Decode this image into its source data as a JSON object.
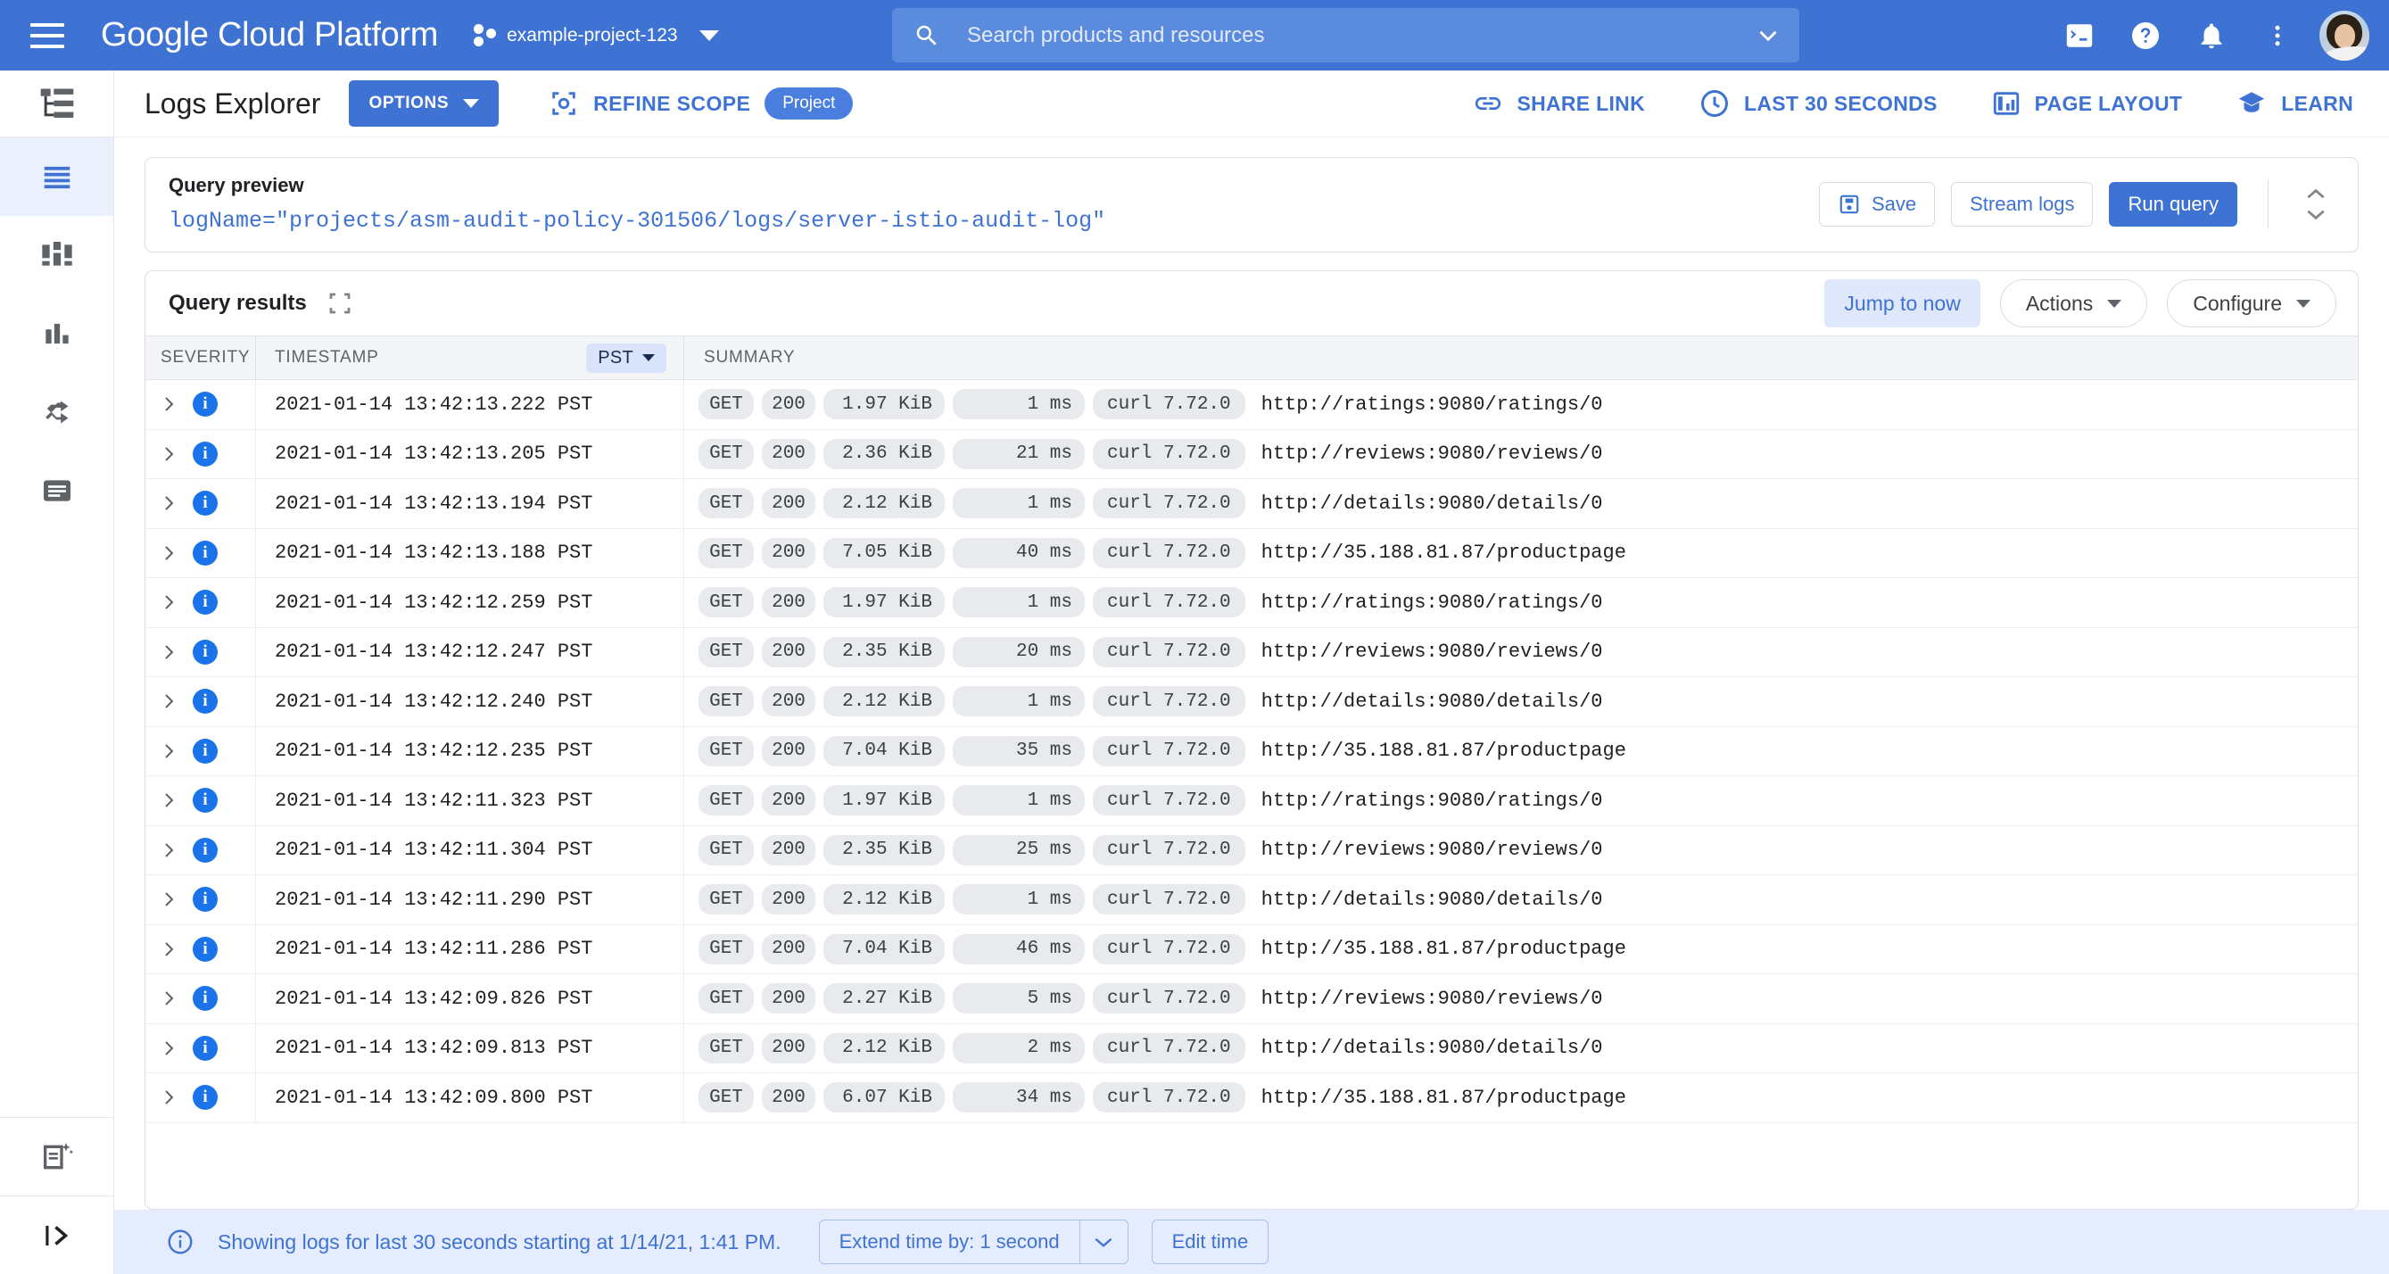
{
  "topbar": {
    "menu_icon": "hamburger-menu-icon",
    "brand": "Google Cloud Platform",
    "project_name": "example-project-123",
    "project_icon": "project-dots-icon",
    "search": {
      "placeholder": "Search products and resources",
      "icon": "search-icon",
      "expand_icon": "chevron-down-icon"
    },
    "icons": [
      "cloud-shell-icon",
      "help-icon",
      "notifications-bell-icon",
      "more-vert-icon",
      "user-avatar"
    ]
  },
  "rail": {
    "top_icon": "logs-hierarchy-icon",
    "items": [
      {
        "name": "logs-explorer",
        "icon": "logs-list-icon",
        "active": true
      },
      {
        "name": "logs-dashboard",
        "icon": "dashboard-icon",
        "active": false
      },
      {
        "name": "logs-metrics",
        "icon": "bar-chart-icon",
        "active": false
      },
      {
        "name": "logs-router",
        "icon": "shuffle-icon",
        "active": false
      },
      {
        "name": "logs-storage",
        "icon": "log-document-icon",
        "active": false
      }
    ],
    "bottom_items": [
      {
        "name": "log-analytics",
        "icon": "smart-document-sparkle-icon"
      },
      {
        "name": "expand-panel",
        "icon": "expand-right-icon"
      }
    ]
  },
  "header": {
    "title": "Logs Explorer",
    "options_label": "OPTIONS",
    "refine_scope_label": "REFINE SCOPE",
    "refine_scope_icon": "scope-target-icon",
    "scope_chip": "Project",
    "actions": [
      {
        "label": "SHARE LINK",
        "icon": "link-icon"
      },
      {
        "label": "LAST 30 SECONDS",
        "icon": "clock-icon"
      },
      {
        "label": "PAGE LAYOUT",
        "icon": "page-layout-icon"
      },
      {
        "label": "LEARN",
        "icon": "learn-book-icon"
      }
    ]
  },
  "query_preview": {
    "title": "Query preview",
    "query": "logName=\"projects/asm-audit-policy-301506/logs/server-istio-audit-log\"",
    "save_label": "Save",
    "save_icon": "save-icon",
    "stream_label": "Stream logs",
    "run_label": "Run query",
    "collapse_icon": "expand-collapse-icon"
  },
  "query_results": {
    "title": "Query results",
    "expand_icon": "fullscreen-icon",
    "jump_label": "Jump to now",
    "actions_label": "Actions",
    "configure_label": "Configure",
    "columns": {
      "severity": "SEVERITY",
      "timestamp": "TIMESTAMP",
      "timezone": "PST",
      "summary": "SUMMARY"
    },
    "rows": [
      {
        "severity": "INFO",
        "timestamp": "2021-01-14 13:42:13.222 PST",
        "method": "GET",
        "status": "200",
        "size": "1.97 KiB",
        "latency": "1 ms",
        "agent": "curl 7.72.0",
        "url": "http://ratings:9080/ratings/0"
      },
      {
        "severity": "INFO",
        "timestamp": "2021-01-14 13:42:13.205 PST",
        "method": "GET",
        "status": "200",
        "size": "2.36 KiB",
        "latency": "21 ms",
        "agent": "curl 7.72.0",
        "url": "http://reviews:9080/reviews/0"
      },
      {
        "severity": "INFO",
        "timestamp": "2021-01-14 13:42:13.194 PST",
        "method": "GET",
        "status": "200",
        "size": "2.12 KiB",
        "latency": "1 ms",
        "agent": "curl 7.72.0",
        "url": "http://details:9080/details/0"
      },
      {
        "severity": "INFO",
        "timestamp": "2021-01-14 13:42:13.188 PST",
        "method": "GET",
        "status": "200",
        "size": "7.05 KiB",
        "latency": "40 ms",
        "agent": "curl 7.72.0",
        "url": "http://35.188.81.87/productpage"
      },
      {
        "severity": "INFO",
        "timestamp": "2021-01-14 13:42:12.259 PST",
        "method": "GET",
        "status": "200",
        "size": "1.97 KiB",
        "latency": "1 ms",
        "agent": "curl 7.72.0",
        "url": "http://ratings:9080/ratings/0"
      },
      {
        "severity": "INFO",
        "timestamp": "2021-01-14 13:42:12.247 PST",
        "method": "GET",
        "status": "200",
        "size": "2.35 KiB",
        "latency": "20 ms",
        "agent": "curl 7.72.0",
        "url": "http://reviews:9080/reviews/0"
      },
      {
        "severity": "INFO",
        "timestamp": "2021-01-14 13:42:12.240 PST",
        "method": "GET",
        "status": "200",
        "size": "2.12 KiB",
        "latency": "1 ms",
        "agent": "curl 7.72.0",
        "url": "http://details:9080/details/0"
      },
      {
        "severity": "INFO",
        "timestamp": "2021-01-14 13:42:12.235 PST",
        "method": "GET",
        "status": "200",
        "size": "7.04 KiB",
        "latency": "35 ms",
        "agent": "curl 7.72.0",
        "url": "http://35.188.81.87/productpage"
      },
      {
        "severity": "INFO",
        "timestamp": "2021-01-14 13:42:11.323 PST",
        "method": "GET",
        "status": "200",
        "size": "1.97 KiB",
        "latency": "1 ms",
        "agent": "curl 7.72.0",
        "url": "http://ratings:9080/ratings/0"
      },
      {
        "severity": "INFO",
        "timestamp": "2021-01-14 13:42:11.304 PST",
        "method": "GET",
        "status": "200",
        "size": "2.35 KiB",
        "latency": "25 ms",
        "agent": "curl 7.72.0",
        "url": "http://reviews:9080/reviews/0"
      },
      {
        "severity": "INFO",
        "timestamp": "2021-01-14 13:42:11.290 PST",
        "method": "GET",
        "status": "200",
        "size": "2.12 KiB",
        "latency": "1 ms",
        "agent": "curl 7.72.0",
        "url": "http://details:9080/details/0"
      },
      {
        "severity": "INFO",
        "timestamp": "2021-01-14 13:42:11.286 PST",
        "method": "GET",
        "status": "200",
        "size": "7.04 KiB",
        "latency": "46 ms",
        "agent": "curl 7.72.0",
        "url": "http://35.188.81.87/productpage"
      },
      {
        "severity": "INFO",
        "timestamp": "2021-01-14 13:42:09.826 PST",
        "method": "GET",
        "status": "200",
        "size": "2.27 KiB",
        "latency": "5 ms",
        "agent": "curl 7.72.0",
        "url": "http://reviews:9080/reviews/0"
      },
      {
        "severity": "INFO",
        "timestamp": "2021-01-14 13:42:09.813 PST",
        "method": "GET",
        "status": "200",
        "size": "2.12 KiB",
        "latency": "2 ms",
        "agent": "curl 7.72.0",
        "url": "http://details:9080/details/0"
      },
      {
        "severity": "INFO",
        "timestamp": "2021-01-14 13:42:09.800 PST",
        "method": "GET",
        "status": "200",
        "size": "6.07 KiB",
        "latency": "34 ms",
        "agent": "curl 7.72.0",
        "url": "http://35.188.81.87/productpage"
      }
    ]
  },
  "statusbar": {
    "icon": "info-outline-icon",
    "message": "Showing logs for last 30 seconds starting at 1/14/21, 1:41 PM.",
    "extend_label": "Extend time by: 1 second",
    "edit_label": "Edit time"
  },
  "colors": {
    "brand_blue": "#3f73d3",
    "accent_blue": "#1a73e8",
    "status_bar_bg": "#e4ecfd",
    "chip_bg": "#e8eaed"
  }
}
